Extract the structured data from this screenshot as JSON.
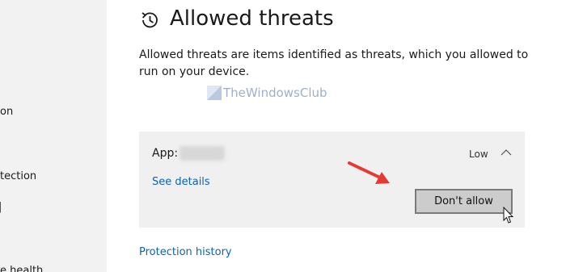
{
  "sidebar": {
    "items": [
      {
        "label": "on"
      },
      {
        "label": "tection"
      },
      {
        "label": "|"
      },
      {
        "label": "e health"
      }
    ]
  },
  "header": {
    "icon": "history-clock-icon",
    "title": "Allowed threats"
  },
  "description": "Allowed threats are items identified as threats, which you allowed to run on your device.",
  "watermark": {
    "text": "TheWindowsClub"
  },
  "threat_card": {
    "app_label": "App:",
    "severity": "Low",
    "see_details": "See details",
    "dont_allow_label": "Don't allow"
  },
  "protection_history": "Protection history",
  "colors": {
    "link": "#0a63b8",
    "sidebar_bg": "#f2f2f2",
    "card_bg": "#f0f0f0",
    "button_bg": "#cccccc",
    "annotation_arrow": "#e53935"
  }
}
